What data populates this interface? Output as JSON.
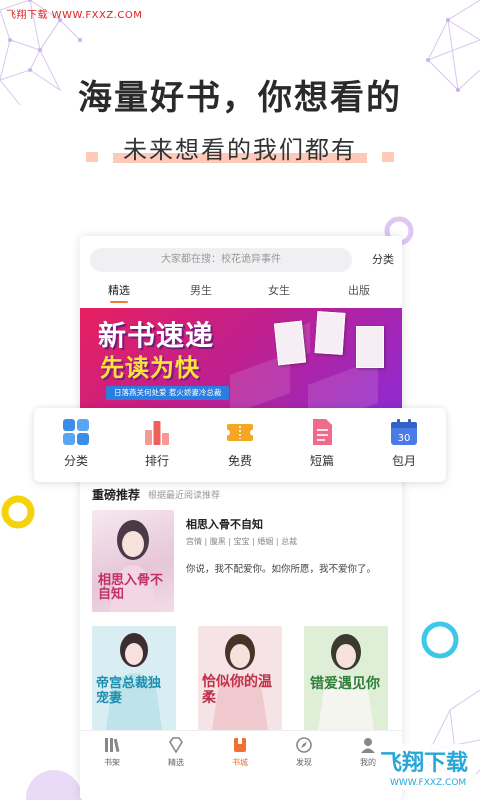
{
  "watermark_top": "飞翔下载 WWW.FXXZ.COM",
  "headline": "海量好书，你想看的",
  "subline": "未来想看的我们都有",
  "app": {
    "search": {
      "placeholder": "大家都在搜：校花诡异事件"
    },
    "category_link": "分类",
    "tabs": [
      {
        "label": "精选",
        "active": true
      },
      {
        "label": "男生"
      },
      {
        "label": "女生"
      },
      {
        "label": "出版"
      }
    ],
    "banner": {
      "line1": "新书速递",
      "line2": "先读为快",
      "ribbon": "日落燕关何处爱 惹火娇妻冷总裁"
    },
    "quick_nav": [
      {
        "label": "分类",
        "icon": "grid-icon",
        "color": "#3b8de8"
      },
      {
        "label": "排行",
        "icon": "bar-chart-icon",
        "color": "#f0605a"
      },
      {
        "label": "免费",
        "icon": "ticket-icon",
        "color": "#f5a623"
      },
      {
        "label": "短篇",
        "icon": "document-icon",
        "color": "#f06a8a"
      },
      {
        "label": "包月",
        "icon": "calendar-icon",
        "color": "#4a7be8",
        "badge": "30"
      }
    ],
    "featured_section": {
      "title": "重磅推荐",
      "subtitle": "根据最近阅读推荐",
      "book": {
        "title": "相思入骨不自知",
        "tags": "宫情 | 腹黑 | 宝宝 | 婚姻 | 总裁",
        "description": "你说，我不配爱你。如你所愿，我不爱你了。",
        "cover_text": "相思入骨不自知"
      }
    },
    "covers": [
      {
        "cover_text": "帝宫总裁独宠妻",
        "bg": "#d9eef2"
      },
      {
        "cover_text": "恰似你的温柔",
        "bg": "#f6e3e5"
      },
      {
        "cover_text": "错爱遇见你",
        "bg": "#dfeed6"
      }
    ],
    "bottom_nav": [
      {
        "label": "书架",
        "icon": "bookshelf-icon"
      },
      {
        "label": "精选",
        "icon": "diamond-icon"
      },
      {
        "label": "书城",
        "icon": "bookstore-icon",
        "active": true
      },
      {
        "label": "发现",
        "icon": "compass-icon"
      },
      {
        "label": "我的",
        "icon": "user-icon"
      }
    ]
  },
  "watermark_bottom": {
    "brand": "飞翔下载",
    "url": "WWW.FXXZ.COM"
  },
  "colors": {
    "accent": "#f27b3a",
    "highlight": "#ffc9b8",
    "deco_purple": "#d7b8f0",
    "deco_yellow": "#f5d20a",
    "deco_cyan": "#3ec8e8"
  }
}
